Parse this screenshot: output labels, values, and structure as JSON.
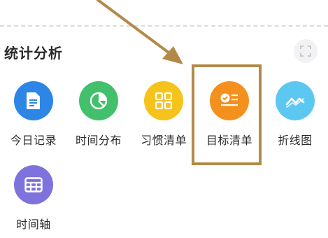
{
  "section": {
    "title": "统计分析",
    "expand_icon": "expand-icon"
  },
  "items": [
    {
      "label": "今日记录",
      "icon": "document-icon",
      "color": "#2d86e6"
    },
    {
      "label": "时间分布",
      "icon": "pie-chart-icon",
      "color": "#43c06b"
    },
    {
      "label": "习惯清单",
      "icon": "grid-icon",
      "color": "#f6c21c"
    },
    {
      "label": "目标清单",
      "icon": "checklist-icon",
      "color": "#f4901e"
    },
    {
      "label": "折线图",
      "icon": "line-chart-icon",
      "color": "#5cc8f2"
    },
    {
      "label": "时间轴",
      "icon": "table-icon",
      "color": "#7e73dc"
    }
  ],
  "annotation": {
    "highlight_color": "#b3894a",
    "highlighted_item": "目标清单"
  }
}
